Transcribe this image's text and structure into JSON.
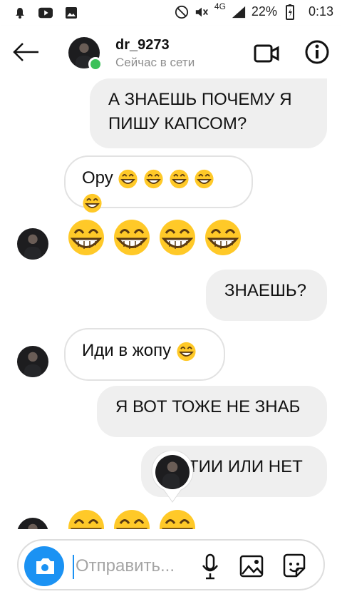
{
  "status_bar": {
    "network": "4G",
    "battery": "22%",
    "time": "0:13"
  },
  "header": {
    "username": "dr_9273",
    "status": "Сейчас в сети"
  },
  "messages": [
    {
      "type": "out",
      "text": "А ЗНАЕШЬ ПОЧЕМУ Я ПИШУ КАПСОМ?"
    },
    {
      "type": "in",
      "text": "Ору"
    },
    {
      "type": "in-emoji"
    },
    {
      "type": "out",
      "text": "ЗНАЕШЬ?"
    },
    {
      "type": "in",
      "text": "Иди в жопу"
    },
    {
      "type": "out",
      "text": "Я ВОТ ТОЖЕ НЕ ЗНАБ"
    },
    {
      "type": "out",
      "text": "ТИИ ИЛИ НЕТ"
    }
  ],
  "composer": {
    "placeholder": "Отправить..."
  }
}
